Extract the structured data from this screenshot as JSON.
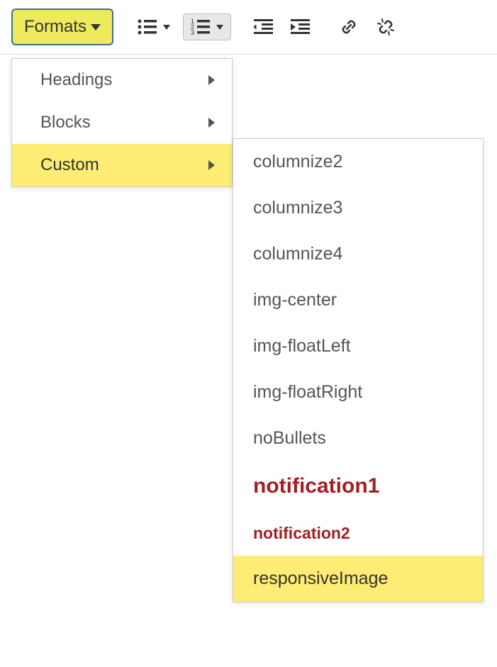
{
  "toolbar": {
    "formats_label": "Formats"
  },
  "menu": {
    "items": [
      {
        "label": "Headings"
      },
      {
        "label": "Blocks"
      },
      {
        "label": "Custom"
      }
    ]
  },
  "submenu": {
    "items": [
      {
        "label": "columnize2",
        "style": "normal"
      },
      {
        "label": "columnize3",
        "style": "normal"
      },
      {
        "label": "columnize4",
        "style": "normal"
      },
      {
        "label": "img-center",
        "style": "normal"
      },
      {
        "label": "img-floatLeft",
        "style": "normal"
      },
      {
        "label": "img-floatRight",
        "style": "normal"
      },
      {
        "label": "noBullets",
        "style": "normal"
      },
      {
        "label": "notification1",
        "style": "notification1"
      },
      {
        "label": "notification2",
        "style": "notification2"
      },
      {
        "label": "responsiveImage",
        "style": "highlighted"
      }
    ]
  }
}
